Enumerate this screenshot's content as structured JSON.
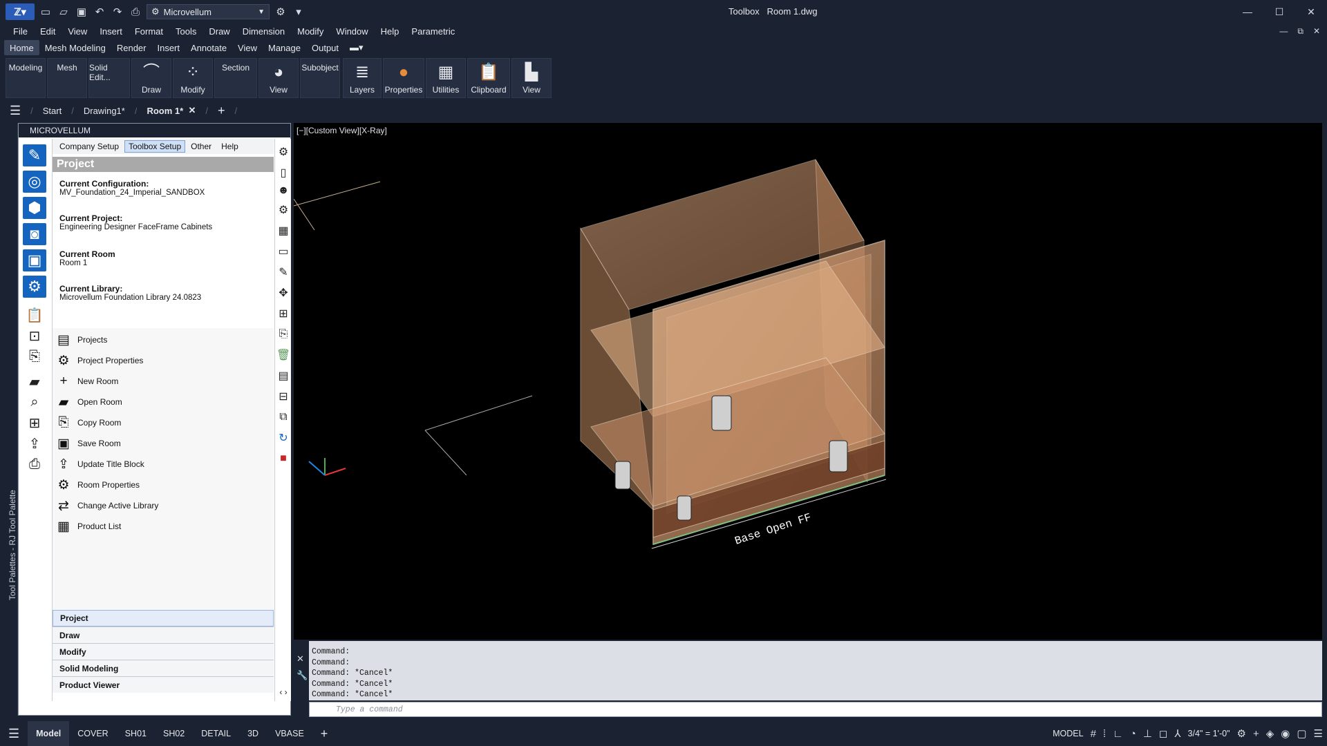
{
  "app": {
    "window_title": "Toolbox",
    "document_title": "Room 1.dwg",
    "workspace": "Microvellum"
  },
  "menu": [
    "File",
    "Edit",
    "View",
    "Insert",
    "Format",
    "Tools",
    "Draw",
    "Dimension",
    "Modify",
    "Window",
    "Help",
    "Parametric"
  ],
  "ribbon_tabs": [
    "Home",
    "Mesh Modeling",
    "Render",
    "Insert",
    "Annotate",
    "View",
    "Manage",
    "Output"
  ],
  "ribbon_panels": [
    "Modeling",
    "Mesh",
    "Solid Edit...",
    "Draw",
    "Modify",
    "Section",
    "View",
    "Subobject",
    "Layers",
    "Properties",
    "Utilities",
    "Clipboard",
    "View"
  ],
  "doc_tabs": [
    "Start",
    "Drawing1*",
    "Room 1*"
  ],
  "palette": {
    "header": "MICROVELLUM",
    "side_label": "Tool Palettes - RJ Tool Palette",
    "tabs": [
      "Company Setup",
      "Toolbox Setup",
      "Other",
      "Help"
    ],
    "section_title": "Project",
    "info": [
      {
        "label": "Current Configuration:",
        "value": "MV_Foundation_24_Imperial_SANDBOX"
      },
      {
        "label": "Current Project:",
        "value": "Engineering Designer FaceFrame Cabinets"
      },
      {
        "label": "Current Room",
        "value": "Room 1"
      },
      {
        "label": "Current Library:",
        "value": "Microvellum Foundation Library 24.0823"
      }
    ],
    "actions": [
      "Projects",
      "Project Properties",
      "New Room",
      "Open Room",
      "Copy Room",
      "Save Room",
      "Update Title Block",
      "Room Properties",
      "Change Active Library",
      "Product List"
    ],
    "accordion": [
      "Project",
      "Draw",
      "Modify",
      "Solid Modeling",
      "Product Viewer"
    ]
  },
  "viewport": {
    "label": "[−][Custom View][X-Ray]",
    "annotation": "Base Open FF"
  },
  "command": {
    "log": [
      "Command:",
      "Command:",
      "Command: *Cancel*",
      "Command: *Cancel*",
      "Command: *Cancel*"
    ],
    "placeholder": "Type a command"
  },
  "layout_tabs": [
    "Model",
    "COVER",
    "SH01",
    "SH02",
    "DETAIL",
    "3D",
    "VBASE"
  ],
  "status": {
    "space": "MODEL",
    "scale": "3/4\" = 1'-0\""
  }
}
